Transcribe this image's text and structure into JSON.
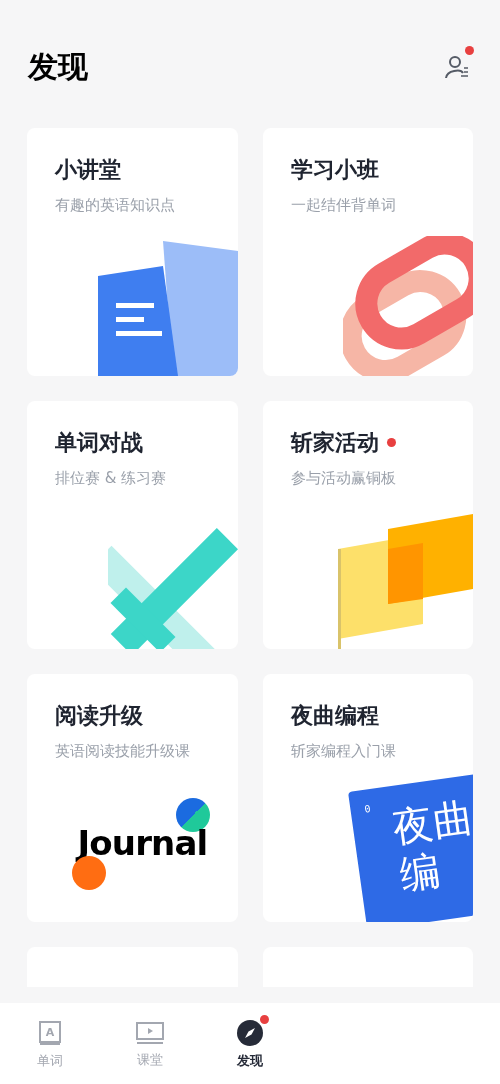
{
  "header": {
    "title": "发现",
    "profile_badge": true
  },
  "cards": [
    {
      "kind": "lecture",
      "title": "小讲堂",
      "subtitle": "有趣的英语知识点",
      "badge": false
    },
    {
      "kind": "group",
      "title": "学习小班",
      "subtitle": "一起结伴背单词",
      "badge": false
    },
    {
      "kind": "battle",
      "title": "单词对战",
      "subtitle": "排位赛 & 练习赛",
      "badge": false
    },
    {
      "kind": "events",
      "title": "斩家活动",
      "subtitle": "参与活动赢铜板",
      "badge": true
    },
    {
      "kind": "reading",
      "title": "阅读升级",
      "subtitle": "英语阅读技能升级课",
      "badge": false,
      "art_text": [
        "Journal"
      ]
    },
    {
      "kind": "coding",
      "title": "夜曲编程",
      "subtitle": "斩家编程入门课",
      "badge": false,
      "art_text": [
        "0",
        "夜曲",
        "编"
      ]
    },
    {
      "kind": "partial"
    },
    {
      "kind": "partial"
    }
  ],
  "tab_bar": [
    {
      "kind": "book",
      "label": "单词",
      "selected": false,
      "badge": false,
      "icon_text": "A"
    },
    {
      "kind": "video",
      "label": "课堂",
      "selected": false,
      "badge": false
    },
    {
      "kind": "compass",
      "label": "发现",
      "selected": true,
      "badge": true
    }
  ]
}
